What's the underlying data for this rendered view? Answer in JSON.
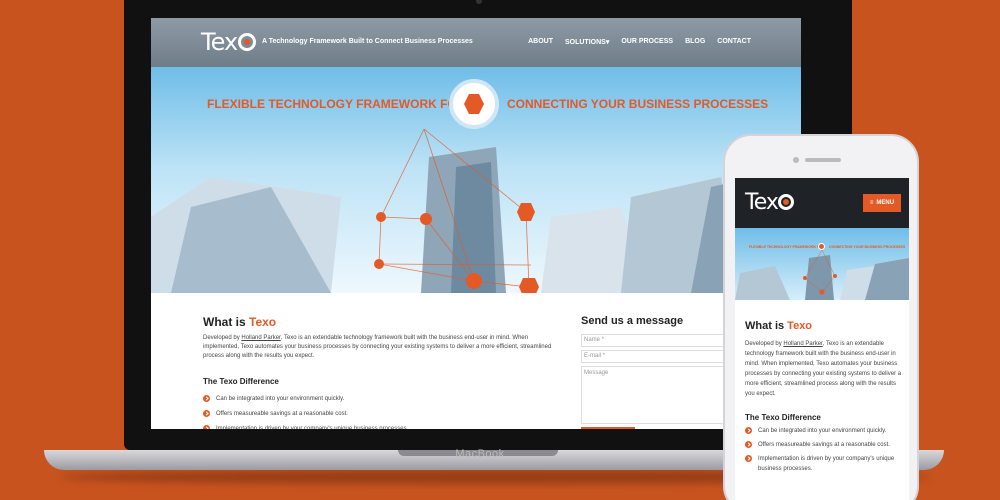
{
  "laptop": {
    "brand": "MacBook"
  },
  "site": {
    "logo_text": "Te",
    "logo_x": "x",
    "tagline": "A Technology Framework Built to Connect Business Processes",
    "nav": [
      "ABOUT",
      "SOLUTIONS",
      "OUR PROCESS",
      "BLOG",
      "CONTACT"
    ],
    "hero": {
      "left_text": "FLEXIBLE TECHNOLOGY FRAMEWORK FOR",
      "right_text": "CONNECTING YOUR BUSINESS PROCESSES"
    },
    "what_is": {
      "prefix": "What is ",
      "brand": "Texo"
    },
    "about_pre": "Developed by ",
    "about_link": "Holland Parker",
    "about_post": ", Texo is an extendable technology framework built with the business end-user in mind. When implemented, Texo automates your business processes by connecting your existing systems to deliver a more efficient, streamlined process along with the results you expect.",
    "difference_title": "The Texo Difference",
    "difference_items": [
      "Can be integrated into your environment quickly.",
      "Offers measureable savings at a reasonable cost.",
      "Implementation is driven by your company's unique business processes."
    ],
    "form": {
      "title": "Send us a message",
      "name_placeholder": "Name *",
      "email_placeholder": "E-mail *",
      "message_placeholder": "Message"
    }
  },
  "mobile": {
    "menu_label": "MENU",
    "hero_left": "FLEXIBLE TECHNOLOGY FRAMEWORK FOR",
    "hero_right": "CONNECTING YOUR BUSINESS PROCESSES"
  },
  "colors": {
    "accent": "#e35a26",
    "background": "#c8531f",
    "header": "#7d8a95"
  }
}
